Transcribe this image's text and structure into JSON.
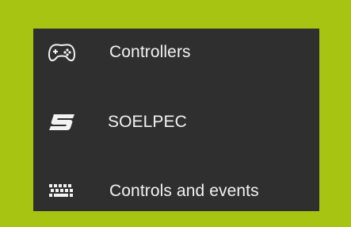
{
  "menu": {
    "items": [
      {
        "label": "Controllers",
        "icon": "gamepad-icon"
      },
      {
        "label": "SOELPEC",
        "icon": "soelpec-logo-icon"
      },
      {
        "label": "Controls and events",
        "icon": "keyboard-icon"
      }
    ]
  },
  "colors": {
    "background": "#a8c413",
    "panel": "#2f2f2f",
    "text": "#f2f2f2"
  }
}
